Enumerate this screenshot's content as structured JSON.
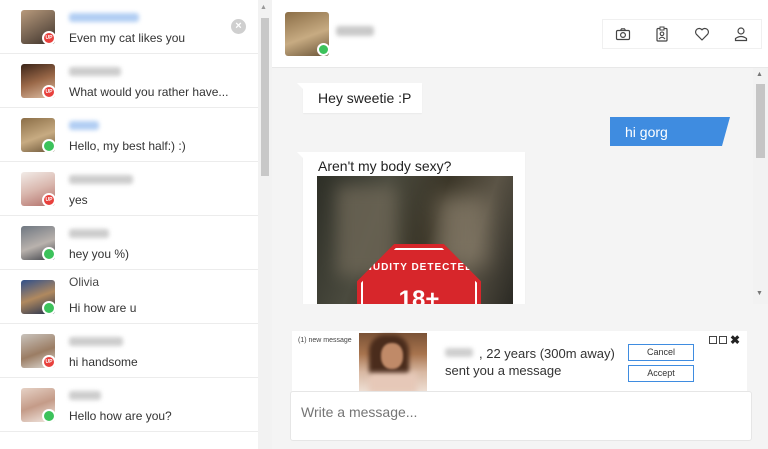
{
  "conversations": [
    {
      "preview": "Even my cat likes you",
      "name_blur": "blue",
      "badge": "up",
      "badge_text": "UP",
      "avatar": "linear-gradient(150deg,#b89a7c,#6f5d4d 60%,#3d3129)",
      "close": "×"
    },
    {
      "preview": "What would you rather have...",
      "name_blur": "gray",
      "badge": "up",
      "badge_text": "UP",
      "avatar": "linear-gradient(160deg,#3a2418,#9a6848 50%,#e0c0a6)"
    },
    {
      "preview": "Hello, my best half:) :)",
      "name_blur": "blue",
      "badge": "on",
      "badge_text": "",
      "avatar": "linear-gradient(160deg,#8b6e47,#c7ab82 55%,#6b5538)"
    },
    {
      "preview": "yes",
      "name_blur": "gray",
      "badge": "up",
      "badge_text": "UP",
      "avatar": "linear-gradient(160deg,#f2ece8,#d9b7ae 50%,#b26f69)"
    },
    {
      "preview": "hey you %)",
      "name_blur": "gray",
      "badge": "on",
      "badge_text": "",
      "avatar": "linear-gradient(160deg,#6f7781,#b9b2ad 55%,#3d4047)"
    },
    {
      "preview": "Hi how are u",
      "name": "Olivia",
      "name_blur": "visible",
      "badge": "on",
      "badge_text": "",
      "avatar": "linear-gradient(160deg,#2f4f8a,#b0895f 50%,#1f2f4f)"
    },
    {
      "preview": "hi handsome",
      "name_blur": "gray",
      "badge": "up",
      "badge_text": "UP",
      "avatar": "linear-gradient(160deg,#c9c3bc,#9b7d64 55%,#e0ddd8)"
    },
    {
      "preview": "Hello how are you?",
      "name_blur": "gray",
      "badge": "on",
      "badge_text": "",
      "avatar": "linear-gradient(160deg,#e6d2c6,#c49b88 50%,#f4ebe5)"
    }
  ],
  "chat": {
    "messages": [
      {
        "text": "Hey sweetie :P",
        "dir": "in"
      },
      {
        "text": "hi gorg",
        "dir": "out"
      },
      {
        "text": "Aren't my body sexy?",
        "dir": "in"
      }
    ],
    "nudity_label": "NUDITY DETECTED",
    "nudity_age": "18+"
  },
  "notification": {
    "label": "(1) new message",
    "line1": ", 22 years (300m away)",
    "line2": "sent you a message",
    "cancel": "Cancel",
    "accept": "Accept",
    "close": "✖"
  },
  "composer": {
    "placeholder": "Write a message..."
  },
  "colors": {
    "accent": "#3f8ce0",
    "online": "#3cc25b",
    "upgrade": "#e8403c",
    "warning": "#d7262b"
  },
  "header_icons": [
    "camera-icon",
    "id-badge-icon",
    "heart-icon",
    "user-icon"
  ],
  "scroll_arrows": {
    "up": "▲",
    "down": "▼"
  }
}
